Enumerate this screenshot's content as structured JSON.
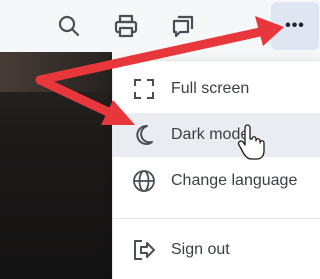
{
  "toolbar": {
    "icons": [
      "search-icon",
      "print-icon",
      "comment-icon",
      "more-icon"
    ],
    "more_label": "•••"
  },
  "menu": {
    "items": [
      {
        "label": "Full screen",
        "icon": "fullscreen-icon"
      },
      {
        "label": "Dark mode",
        "icon": "moon-icon"
      },
      {
        "label": "Change language",
        "icon": "globe-icon"
      },
      {
        "label": "Sign out",
        "icon": "sign-out-icon"
      }
    ],
    "hovered_item": "Dark mode"
  },
  "annotation": {
    "arrow_color": "#e8373a"
  }
}
